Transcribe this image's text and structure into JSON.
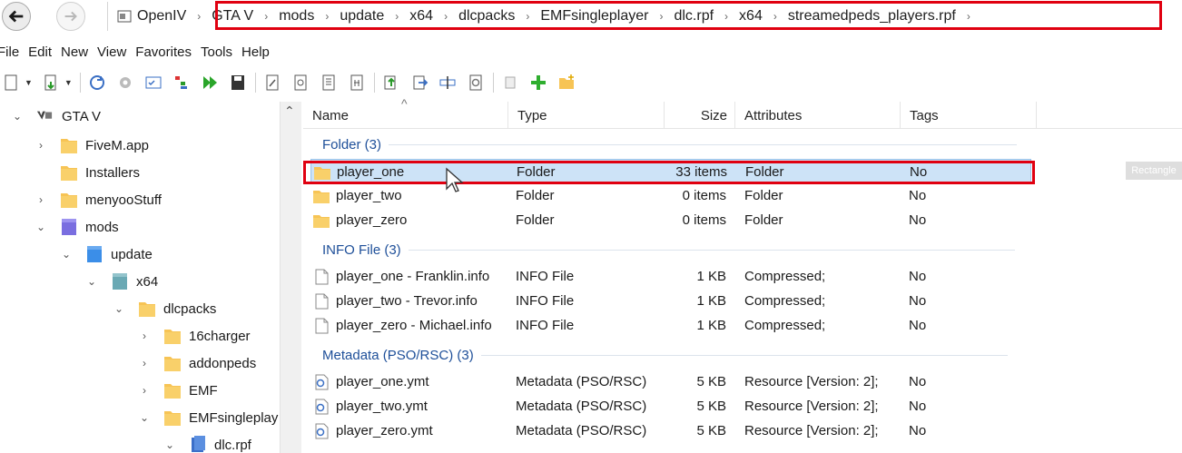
{
  "address_bar": {
    "app_name": "OpenIV",
    "path": [
      "GTA V",
      "mods",
      "update",
      "x64",
      "dlcpacks",
      "EMFsingleplayer",
      "dlc.rpf",
      "x64",
      "streamedpeds_players.rpf"
    ]
  },
  "menu": [
    "File",
    "Edit",
    "New",
    "View",
    "Favorites",
    "Tools",
    "Help"
  ],
  "tree": {
    "root": "GTA V",
    "items": [
      {
        "label": "FiveM.app",
        "indent": 0,
        "twisty": "›"
      },
      {
        "label": "Installers",
        "indent": 0,
        "twisty": ""
      },
      {
        "label": "menyooStuff",
        "indent": 0,
        "twisty": "›"
      },
      {
        "label": "mods",
        "indent": 0,
        "twisty": "⌄"
      },
      {
        "label": "update",
        "indent": 1,
        "twisty": "⌄"
      },
      {
        "label": "x64",
        "indent": 2,
        "twisty": "⌄"
      },
      {
        "label": "dlcpacks",
        "indent": 3,
        "twisty": "⌄"
      },
      {
        "label": "16charger",
        "indent": 4,
        "twisty": "›"
      },
      {
        "label": "addonpeds",
        "indent": 4,
        "twisty": "›"
      },
      {
        "label": "EMF",
        "indent": 4,
        "twisty": "›"
      },
      {
        "label": "EMFsingleplay",
        "indent": 4,
        "twisty": "⌄"
      },
      {
        "label": "dlc.rpf",
        "indent": 5,
        "twisty": "⌄"
      }
    ]
  },
  "columns": {
    "name": "Name",
    "type": "Type",
    "size": "Size",
    "attributes": "Attributes",
    "tags": "Tags"
  },
  "groups": [
    {
      "label": "Folder (3)",
      "rows": [
        {
          "name": "player_one",
          "type": "Folder",
          "size": "33 items",
          "attributes": "Folder",
          "tags": "No",
          "icon": "folder-icon",
          "selected": true
        },
        {
          "name": "player_two",
          "type": "Folder",
          "size": "0 items",
          "attributes": "Folder",
          "tags": "No",
          "icon": "folder-icon"
        },
        {
          "name": "player_zero",
          "type": "Folder",
          "size": "0 items",
          "attributes": "Folder",
          "tags": "No",
          "icon": "folder-icon"
        }
      ]
    },
    {
      "label": "INFO File (3)",
      "rows": [
        {
          "name": "player_one - Franklin.info",
          "type": "INFO File",
          "size": "1 KB",
          "attributes": "Compressed;",
          "tags": "No",
          "icon": "document-icon"
        },
        {
          "name": "player_two - Trevor.info",
          "type": "INFO File",
          "size": "1 KB",
          "attributes": "Compressed;",
          "tags": "No",
          "icon": "document-icon"
        },
        {
          "name": "player_zero - Michael.info",
          "type": "INFO File",
          "size": "1 KB",
          "attributes": "Compressed;",
          "tags": "No",
          "icon": "document-icon"
        }
      ]
    },
    {
      "label": "Metadata (PSO/RSC) (3)",
      "rows": [
        {
          "name": "player_one.ymt",
          "type": "Metadata (PSO/RSC)",
          "size": "5 KB",
          "attributes": "Resource [Version: 2];",
          "tags": "No",
          "icon": "metadata-file-icon"
        },
        {
          "name": "player_two.ymt",
          "type": "Metadata (PSO/RSC)",
          "size": "5 KB",
          "attributes": "Resource [Version: 2];",
          "tags": "No",
          "icon": "metadata-file-icon"
        },
        {
          "name": "player_zero.ymt",
          "type": "Metadata (PSO/RSC)",
          "size": "5 KB",
          "attributes": "Resource [Version: 2];",
          "tags": "No",
          "icon": "metadata-file-icon"
        }
      ]
    }
  ],
  "overlay_tag": "Rectangle",
  "colors": {
    "highlight_red": "#e00010",
    "selection_bg": "#cde3f7",
    "group_text": "#1e4f99",
    "folder": "#f7c455"
  }
}
